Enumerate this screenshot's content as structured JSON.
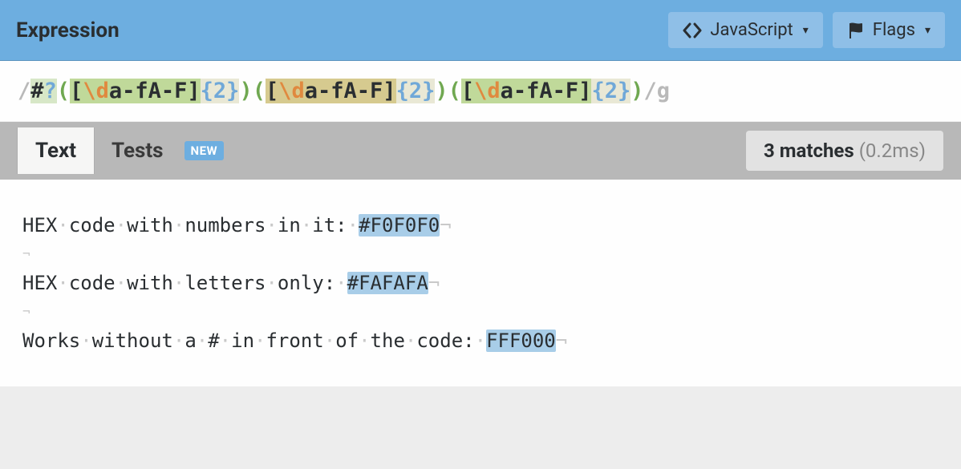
{
  "header": {
    "title": "Expression",
    "jsButton": "JavaScript",
    "flagsButton": "Flags",
    "caret": "▾"
  },
  "expression": {
    "open": "/",
    "close": "/",
    "literal_hash": "#",
    "optional": "?",
    "paren_open": "(",
    "paren_close": ")",
    "bracket_open": "[",
    "escape_d": "\\d",
    "range_af": "a-fA-F",
    "bracket_close": "]",
    "quant": "{2}",
    "flag": "g"
  },
  "tabs": {
    "text": "Text",
    "tests": "Tests",
    "newBadge": "NEW"
  },
  "matches": {
    "count": "3 matches",
    "time": "(0.2ms)"
  },
  "sample": {
    "lines": [
      {
        "prefix_words": [
          "HEX",
          "code",
          "with",
          "numbers",
          "in",
          "it:"
        ],
        "match": "#F0F0F0"
      },
      {
        "prefix_words": [
          "HEX",
          "code",
          "with",
          "letters",
          "only:"
        ],
        "match": "#FAFAFA"
      },
      {
        "prefix_words": [
          "Works",
          "without",
          "a",
          "#",
          "in",
          "front",
          "of",
          "the",
          "code:"
        ],
        "match": "FFF000"
      }
    ],
    "dot": "·",
    "eol": "¬"
  }
}
